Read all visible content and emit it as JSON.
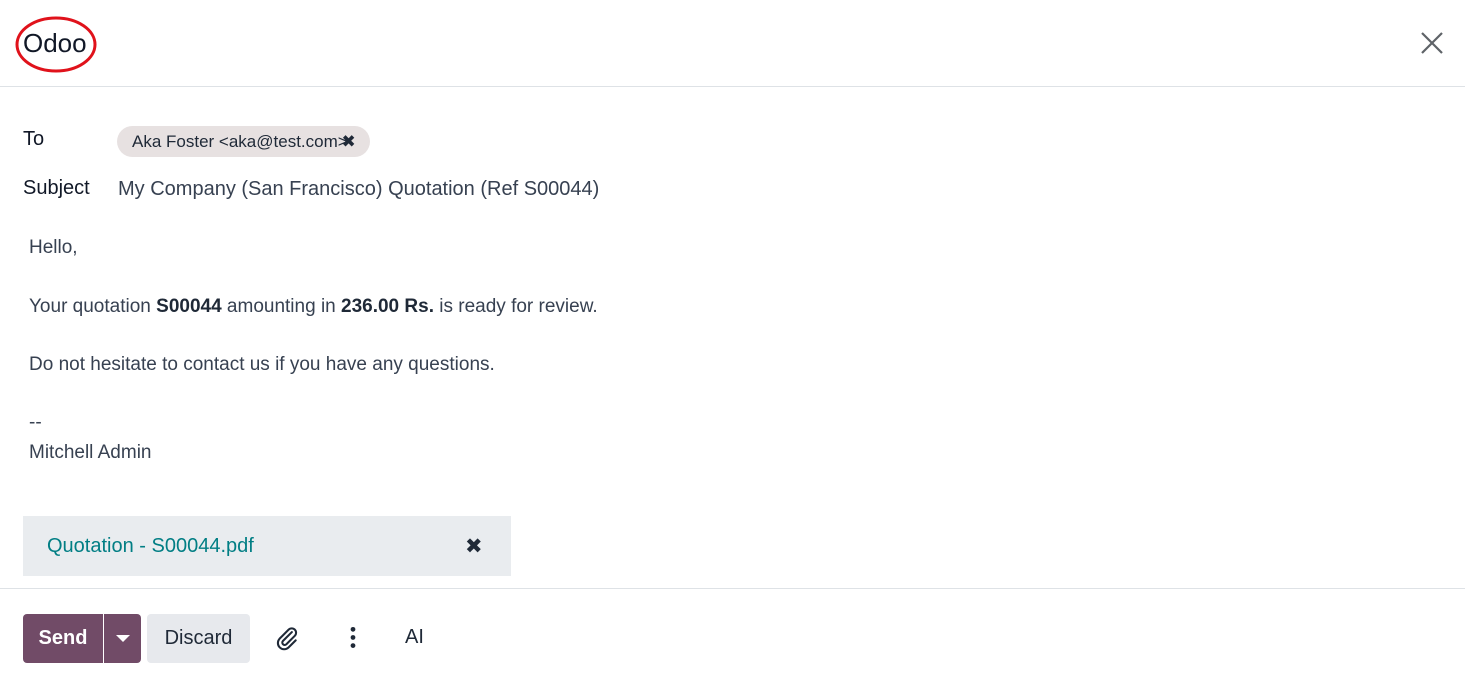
{
  "dialog": {
    "title": "Odoo",
    "close_icon": "close-icon"
  },
  "fields": {
    "to_label": "To",
    "recipients": [
      "Aka Foster <aka@test.com>"
    ],
    "recipient_remove_icon": "remove-tag-icon",
    "subject_label": "Subject",
    "subject_value": "My Company (San Francisco) Quotation (Ref S00044)"
  },
  "body": {
    "greeting": "Hello,",
    "line2_pre": "Your quotation ",
    "quotation_ref": "S00044",
    "line2_mid": " amounting in ",
    "amount": "236.00 Rs.",
    "line2_post": " is ready for review.",
    "line3": "Do not hesitate to contact us if you have any questions.",
    "signature_sep": "--",
    "signature_name": "Mitchell Admin"
  },
  "attachment": {
    "filename": "Quotation - S00044.pdf",
    "remove_icon": "remove-attachment-icon"
  },
  "footer": {
    "send_label": "Send",
    "send_dropdown_icon": "caret-down-icon",
    "discard_label": "Discard",
    "attach_icon": "paperclip-icon",
    "more_icon": "vertical-dots-icon",
    "ai_label": "AI"
  },
  "colors": {
    "primary": "#714b67",
    "link": "#017e84",
    "annotation_ring": "#e0121b"
  }
}
